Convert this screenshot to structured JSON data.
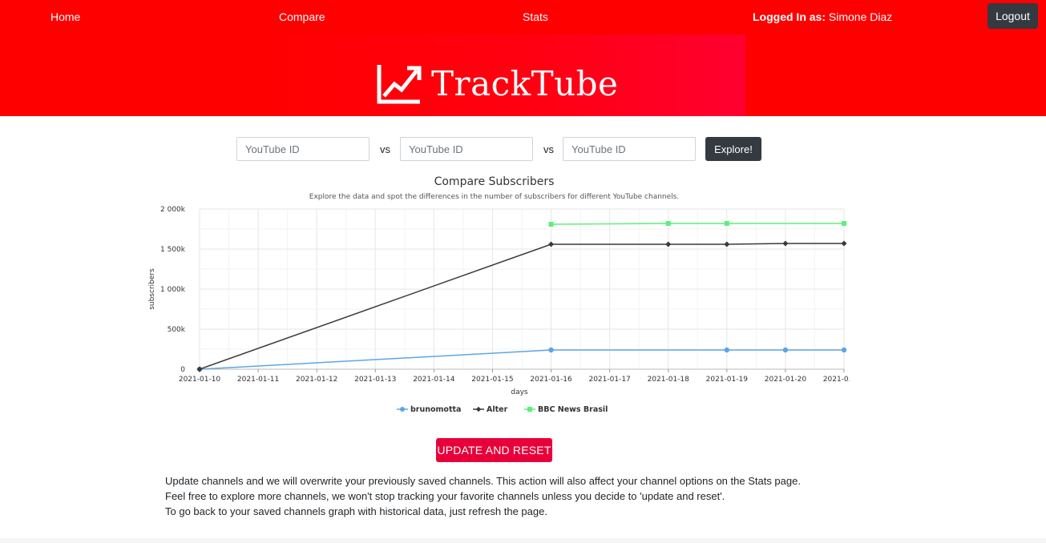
{
  "nav": {
    "home": "Home",
    "compare": "Compare",
    "stats": "Stats",
    "logged_label": "Logged In as:",
    "user_name": "Simone Diaz",
    "logout": "Logout"
  },
  "brand": {
    "name": "TrackTube",
    "icon": "trending-up-icon",
    "color": "#ff0000"
  },
  "search": {
    "placeholder": "YouTube ID",
    "vs": "vs",
    "explore": "Explore!"
  },
  "chart_data": {
    "type": "line",
    "title": "Compare Subscribers",
    "subtitle": "Explore the data and spot the differences in the number of subscribers for different YouTube channels.",
    "xlabel": "days",
    "ylabel": "subscribers",
    "ylim": [
      0,
      2000000
    ],
    "y_ticks": [
      "0",
      "500k",
      "1 000k",
      "1 500k",
      "2 000k"
    ],
    "x_ticks": [
      "2021-01-10",
      "2021-01-11",
      "2021-01-12",
      "2021-01-13",
      "2021-01-14",
      "2021-01-15",
      "2021-01-16",
      "2021-01-17",
      "2021-01-18",
      "2021-01-19",
      "2021-01-20",
      "2021-0..."
    ],
    "x_range": [
      "2021-01-10",
      "2021-01-21"
    ],
    "grid": true,
    "legend_position": "bottom",
    "series": [
      {
        "name": "brunomotta",
        "color": "#5da5e8",
        "marker": "circle",
        "points": [
          [
            "2021-01-10",
            0
          ],
          [
            "2021-01-16",
            240000
          ],
          [
            "2021-01-19",
            240000
          ],
          [
            "2021-01-20",
            240000
          ],
          [
            "2021-01-21",
            240000
          ]
        ]
      },
      {
        "name": "Alter",
        "color": "#3a3a3a",
        "marker": "diamond",
        "points": [
          [
            "2021-01-10",
            0
          ],
          [
            "2021-01-16",
            1560000
          ],
          [
            "2021-01-18",
            1560000
          ],
          [
            "2021-01-19",
            1560000
          ],
          [
            "2021-01-20",
            1570000
          ],
          [
            "2021-01-21",
            1570000
          ]
        ]
      },
      {
        "name": "BBC News Brasil",
        "color": "#5cf07a",
        "marker": "square",
        "points": [
          [
            "2021-01-16",
            1810000
          ],
          [
            "2021-01-18",
            1820000
          ],
          [
            "2021-01-19",
            1820000
          ],
          [
            "2021-01-21",
            1820000
          ]
        ]
      }
    ]
  },
  "update_button": "UPDATE AND RESET",
  "info": {
    "line1": "Update channels and we will overwrite your previously saved channels. This action will also affect your channel options on the Stats page.",
    "line2": "Feel free to explore more channels, we won't stop tracking your favorite channels unless you decide to 'update and reset'.",
    "line3": "To go back to your saved channels graph with historical data, just refresh the page."
  }
}
